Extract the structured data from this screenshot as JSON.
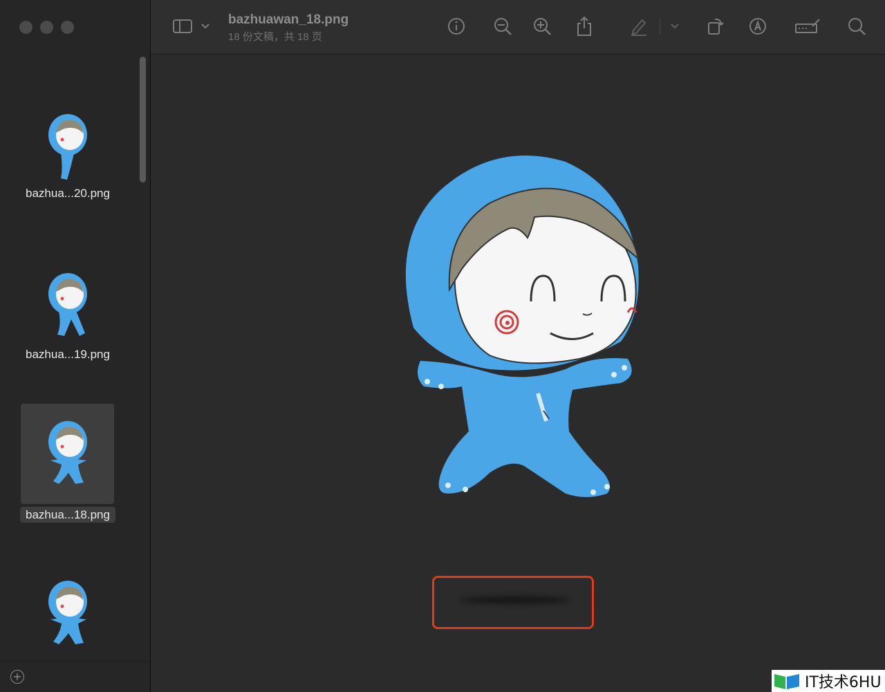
{
  "window": {
    "title": "bazhuawan_18.png",
    "subtitle": "18 份文稿，共 18 页"
  },
  "sidebar": {
    "items": [
      {
        "label": "bazhua...20.png",
        "selected": false
      },
      {
        "label": "bazhua...19.png",
        "selected": false
      },
      {
        "label": "bazhua...18.png",
        "selected": true
      },
      {
        "label": "",
        "selected": false
      }
    ]
  },
  "toolbar": {
    "icons": [
      "sidebar-toggle-icon",
      "chevron-down-icon",
      "info-icon",
      "zoom-out-icon",
      "zoom-in-icon",
      "share-icon",
      "markup-pen-icon",
      "chevron-down-icon",
      "rotate-icon",
      "annotate-icon",
      "sign-icon",
      "search-icon"
    ]
  },
  "watermark": {
    "text": "IT技术6HU"
  },
  "colors": {
    "accent_highlight": "#e03a1e",
    "mascot_blue": "#4aa6e6",
    "mascot_hair": "#8f8a78"
  }
}
